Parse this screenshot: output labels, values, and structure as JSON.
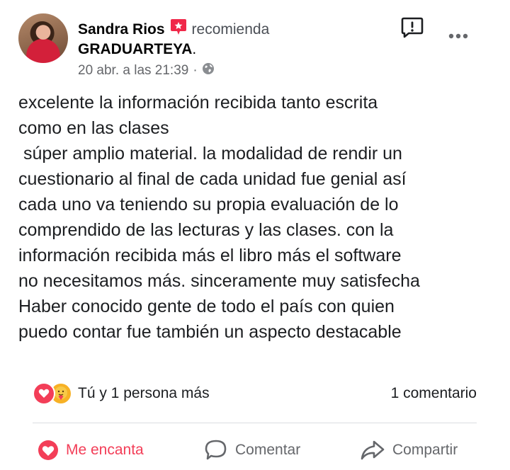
{
  "post": {
    "author": "Sandra Rios",
    "action": "recomienda",
    "page": "GRADUARTEYA",
    "page_suffix": ".",
    "date": "20 abr. a las 21:39",
    "separator": "·",
    "privacy_icon": "globe-icon",
    "body": "excelente la información recibida tanto escrita\ncomo en las clases\n súper amplio material. la modalidad de rendir un\ncuestionario al final de cada unidad fue genial así\ncada uno va teniendo su propia evaluación de lo\ncomprendido de las lecturas y las clases. con la\ninformación recibida más el libro más el software\nno necesitamos más. sinceramente muy satisfecha\nHaber conocido gente de todo el país con quien\npuedo contar fue también un aspecto destacable"
  },
  "reactions": {
    "icons": [
      "love-reaction-icon",
      "care-reaction-icon"
    ],
    "text": "Tú y 1 persona más"
  },
  "comments": {
    "count_text": "1 comentario"
  },
  "actions": {
    "love_label": "Me encanta",
    "comment_label": "Comentar",
    "share_label": "Compartir"
  },
  "colors": {
    "love": "#f33e58",
    "recommend_badge": "#f02849",
    "secondary_text": "#65676b"
  }
}
